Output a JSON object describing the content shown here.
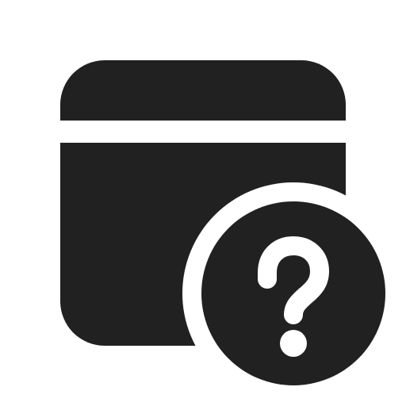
{
  "icon": {
    "name": "window-question-icon",
    "parts": [
      "window-header-icon",
      "window-body-icon",
      "question-badge-icon",
      "question-mark-icon"
    ],
    "colors": {
      "glyph": "#212121",
      "background": "#ffffff"
    }
  }
}
